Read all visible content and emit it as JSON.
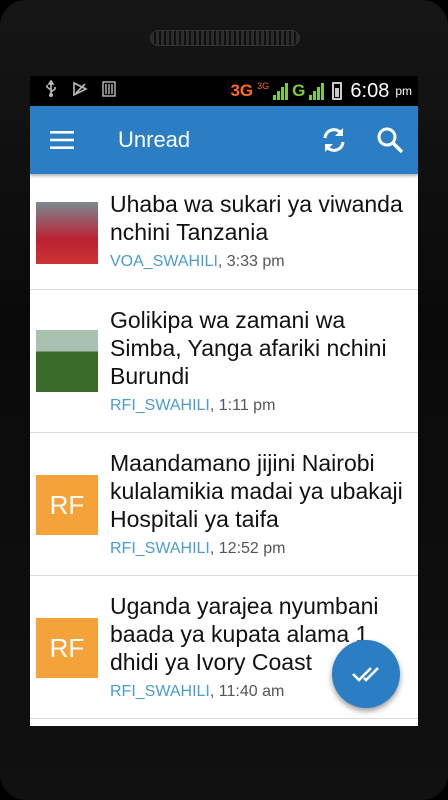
{
  "status_bar": {
    "network_primary": "3G",
    "network_sup": "3G",
    "network_secondary": "G",
    "time": "6:08",
    "ampm": "pm",
    "icons": [
      "usb-icon",
      "media-icon",
      "sim-icon",
      "signal-icon",
      "battery-icon"
    ]
  },
  "app_bar": {
    "title": "Unread",
    "menu_icon": "hamburger-menu-icon",
    "refresh_icon": "refresh-icon",
    "search_icon": "search-icon",
    "color": "#2b7ec3"
  },
  "articles": [
    {
      "headline": "Uhaba wa sukari ya viwanda nchini Tanzania",
      "source": "VOA_SWAHILI",
      "time": ", 3:33 pm",
      "thumbnail": "photo"
    },
    {
      "headline": "Golikipa wa zamani wa Simba, Yanga afariki nchini Burundi",
      "source": "RFI_SWAHILI",
      "time": ", 1:11 pm",
      "thumbnail": "photo"
    },
    {
      "headline": "Maandamano jijini Nairobi kulalamikia madai ya ubakaji Hospitali ya taifa",
      "source": "RFI_SWAHILI",
      "time": ", 12:52 pm",
      "thumbnail": "RF"
    },
    {
      "headline": "Uganda yarajea nyumbani baada ya kupata alama 1 dhidi ya Ivory Coast",
      "source": "RFI_SWAHILI",
      "time": ", 11:40 am",
      "thumbnail": "RF"
    }
  ],
  "fab": {
    "icon": "double-check-icon"
  }
}
